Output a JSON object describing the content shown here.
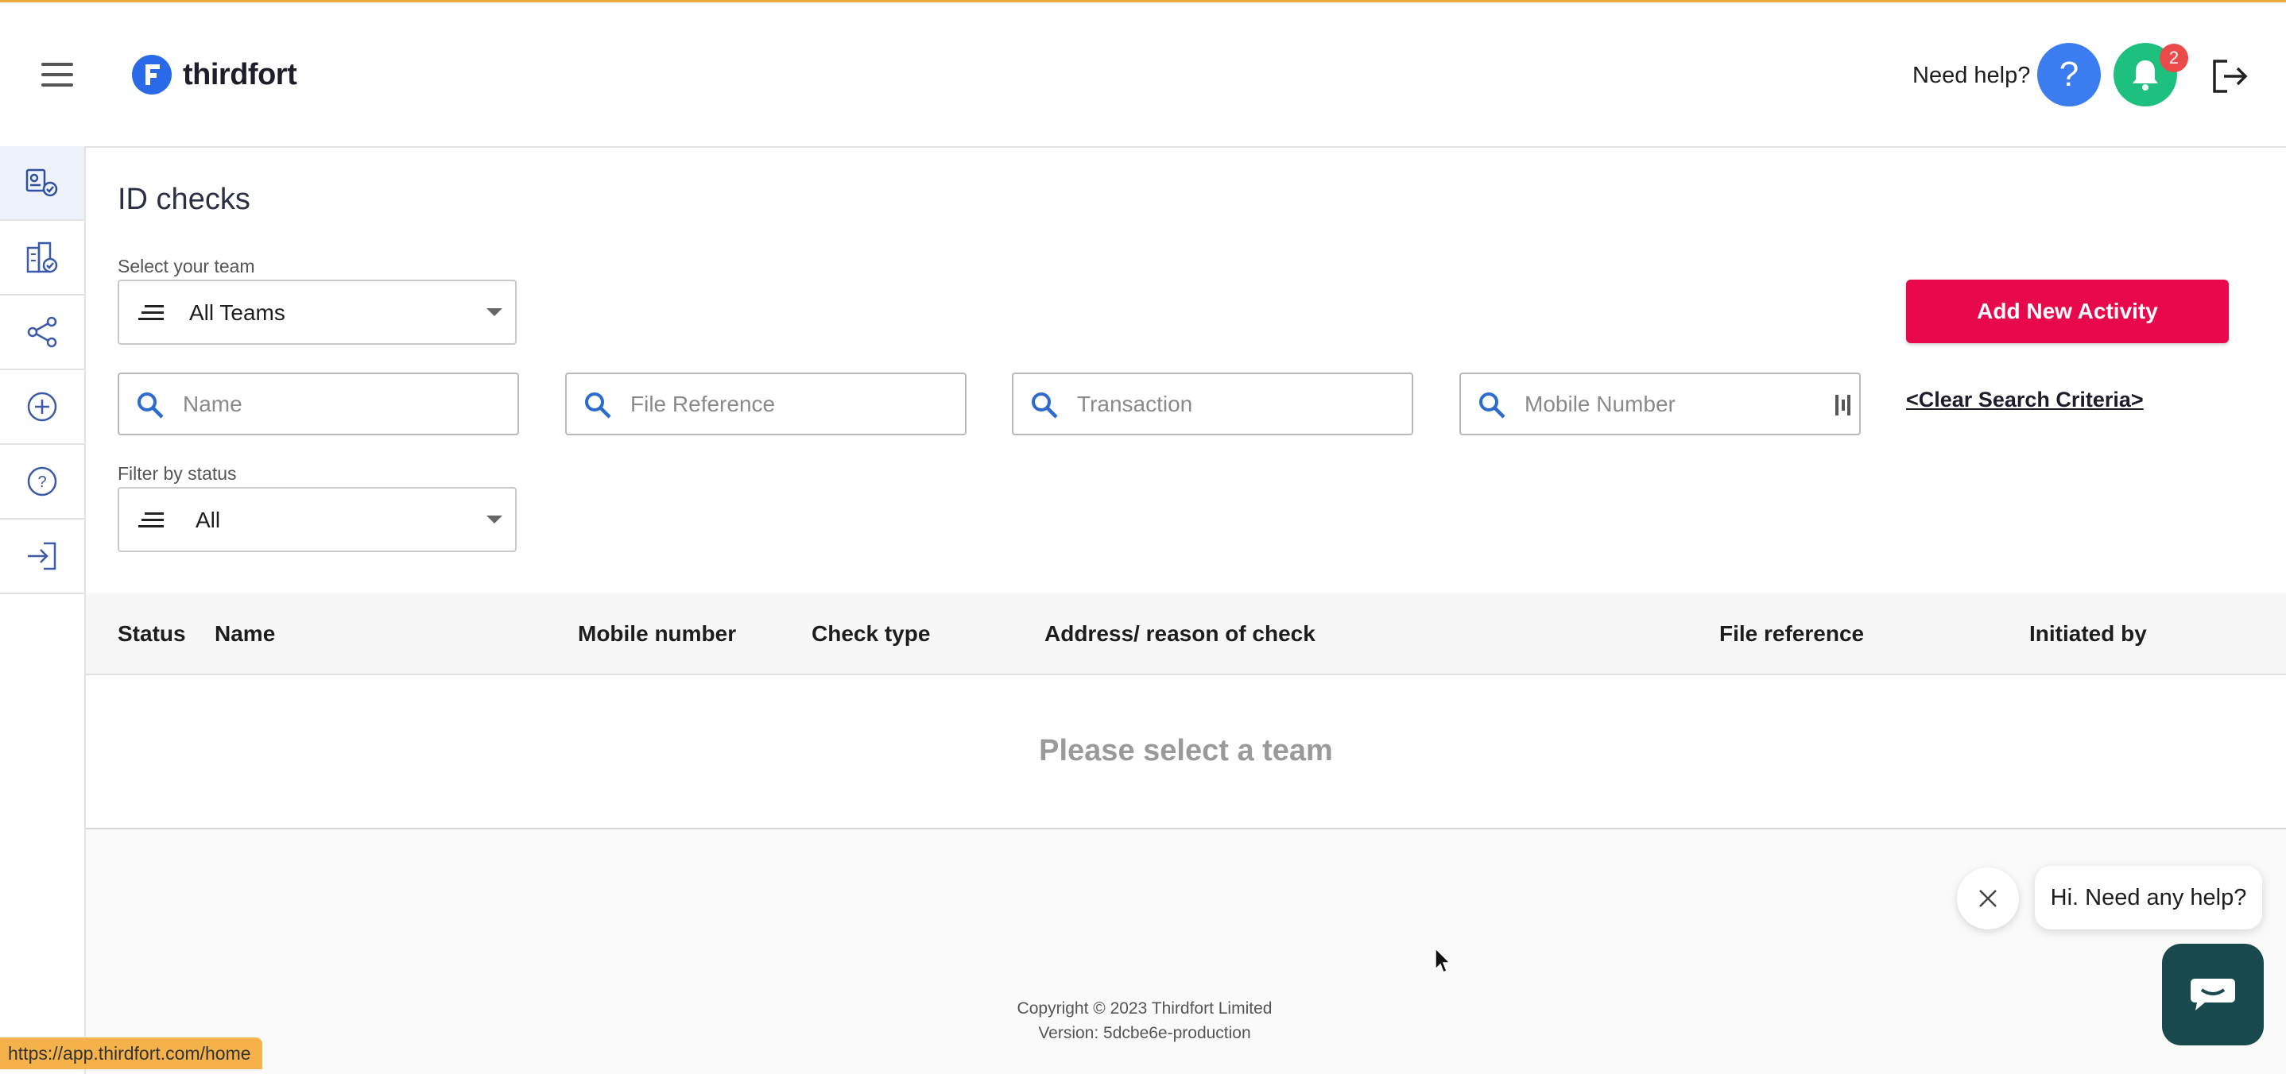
{
  "app": {
    "brand": "thirdfort",
    "need_help": "Need help?",
    "help_symbol": "?",
    "notification_count": "2",
    "accent_color": "#e8094d",
    "brand_color": "#2a6ae8"
  },
  "sidebar": {
    "items": [
      {
        "icon": "id-checks-icon",
        "active": true
      },
      {
        "icon": "building-check-icon",
        "active": false
      },
      {
        "icon": "share-icon",
        "active": false
      },
      {
        "icon": "add-circle-icon",
        "active": false
      },
      {
        "icon": "help-circle-icon",
        "active": false
      },
      {
        "icon": "login-icon",
        "active": false
      }
    ]
  },
  "main": {
    "title": "ID checks",
    "team_label": "Select your team",
    "team_value": "All Teams",
    "status_label": "Filter by status",
    "status_value": "All",
    "add_button": "Add New Activity",
    "clear_link": "<Clear Search Criteria>",
    "search": {
      "name_placeholder": "Name",
      "file_ref_placeholder": "File Reference",
      "transaction_placeholder": "Transaction",
      "mobile_placeholder": "Mobile Number"
    }
  },
  "table": {
    "headers": [
      "Status",
      "Name",
      "Mobile number",
      "Check type",
      "Address/ reason of check",
      "File reference",
      "Initiated by"
    ],
    "empty_message": "Please select a team"
  },
  "footer": {
    "copyright": "Copyright © 2023 Thirdfort Limited",
    "version": "Version: 5dcbe6e-production"
  },
  "chat": {
    "greeting": "Hi. Need any help?"
  },
  "status_bar": {
    "url": "https://app.thirdfort.com/home"
  }
}
